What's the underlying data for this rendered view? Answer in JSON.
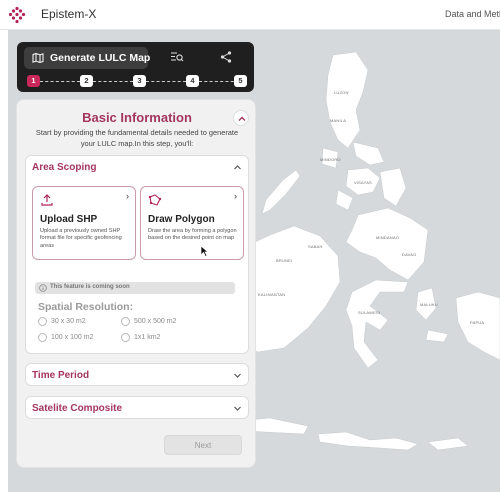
{
  "app": {
    "title": "Epistem-X",
    "nav_link": "Data and Metho"
  },
  "toolbar": {
    "generate_label": "Generate LULC Map",
    "icons": [
      "map-icon",
      "search-list-icon",
      "share-icon"
    ],
    "steps": [
      "1",
      "2",
      "3",
      "4",
      "5"
    ],
    "active_step": 1
  },
  "panel": {
    "title": "Basic Information",
    "description": "Start by providing the fundamental details needed to generate your LULC map.In this step, you'll:",
    "area_scoping": {
      "title": "Area Scoping",
      "cards": [
        {
          "title": "Upload SHP",
          "desc": "Upload a previously owned SHP format file for specific geofencing areas",
          "icon": "upload-icon"
        },
        {
          "title": "Draw Polygon",
          "desc": "Draw the area by forming a polygon based on the desired point on map",
          "icon": "polygon-icon"
        }
      ],
      "notice": "This feature is coming soon",
      "resolution_title": "Spatial Resolution:",
      "resolutions": [
        "30 x 30 m2",
        "500 x 500 m2",
        "100 x 100 m2",
        "1x1 km2"
      ]
    },
    "time_period": {
      "title": "Time Period"
    },
    "satellite": {
      "title": "Satelite Composite"
    },
    "next_label": "Next"
  },
  "map": {
    "labels": [
      "LUZON",
      "MANILA",
      "MINDORO",
      "VISAYAS",
      "MINDANAO",
      "DAVAO",
      "SABAH",
      "KALIMANTAN",
      "BRUNEI",
      "SULAWESI",
      "MALUKU",
      "PAPUA"
    ]
  },
  "colors": {
    "accent": "#a3355f",
    "step_active": "#c8285a",
    "toolbar_bg": "#1f1f1f",
    "map_sea": "#d6d9db",
    "map_land": "#ffffff"
  }
}
